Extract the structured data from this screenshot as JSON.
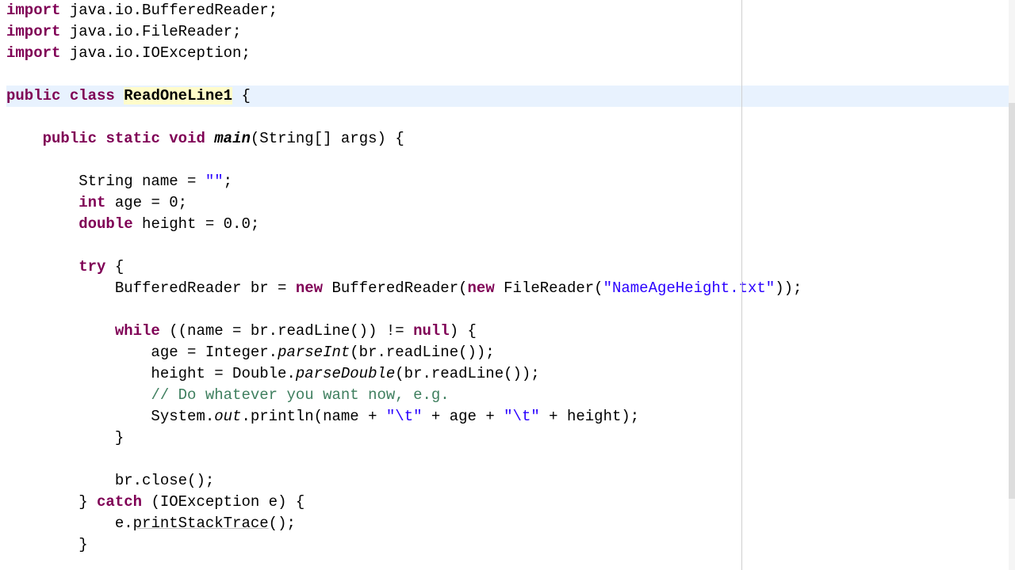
{
  "lines": {
    "l1_kw": "import",
    "l1_r": " java.io.BufferedReader;",
    "l2_kw": "import",
    "l2_r": " java.io.FileReader;",
    "l3_kw": "import",
    "l3_r": " java.io.IOException;",
    "l4": "",
    "l5_kw1": "public",
    "l5_kw2": "class",
    "l5_name": "ReadOneLine1",
    "l5_r": " {",
    "l6": "",
    "l7_pre": "    ",
    "l7_kw1": "public",
    "l7_kw2": "static",
    "l7_kw3": "void",
    "l7_main": "main",
    "l7_r": "(String[] args) {",
    "l8": "",
    "l9_pre": "        String name = ",
    "l9_str": "\"\"",
    "l9_r": ";",
    "l10_pre": "        ",
    "l10_kw": "int",
    "l10_r": " age = 0;",
    "l11_pre": "        ",
    "l11_kw": "double",
    "l11_r": " height = 0.0;",
    "l12": "",
    "l13_pre": "        ",
    "l13_kw": "try",
    "l13_r": " {",
    "l14_pre": "            BufferedReader br = ",
    "l14_kw1": "new",
    "l14_mid": " BufferedReader(",
    "l14_kw2": "new",
    "l14_mid2": " FileReader(",
    "l14_str": "\"NameAgeHeight.txt\"",
    "l14_r": "));",
    "l15": "",
    "l16_pre": "            ",
    "l16_kw": "while",
    "l16_mid": " ((name = br.readLine()) != ",
    "l16_null": "null",
    "l16_r": ") {",
    "l17_pre": "                age = Integer.",
    "l17_m": "parseInt",
    "l17_r": "(br.readLine());",
    "l18_pre": "                height = Double.",
    "l18_m": "parseDouble",
    "l18_r": "(br.readLine());",
    "l19_pre": "                ",
    "l19_c": "// Do whatever you want now, e.g.",
    "l20_pre": "                System.",
    "l20_out": "out",
    "l20_mid": ".println(name + ",
    "l20_s1": "\"\\t\"",
    "l20_mid2": " + age + ",
    "l20_s2": "\"\\t\"",
    "l20_r": " + height);",
    "l21": "            }",
    "l22": "",
    "l23": "            br.close();",
    "l24_pre": "        } ",
    "l24_kw": "catch",
    "l24_r": " (IOException e) {",
    "l25_pre": "            e.",
    "l25_m": "printStackTrace",
    "l25_r": "();",
    "l26": "        }"
  }
}
